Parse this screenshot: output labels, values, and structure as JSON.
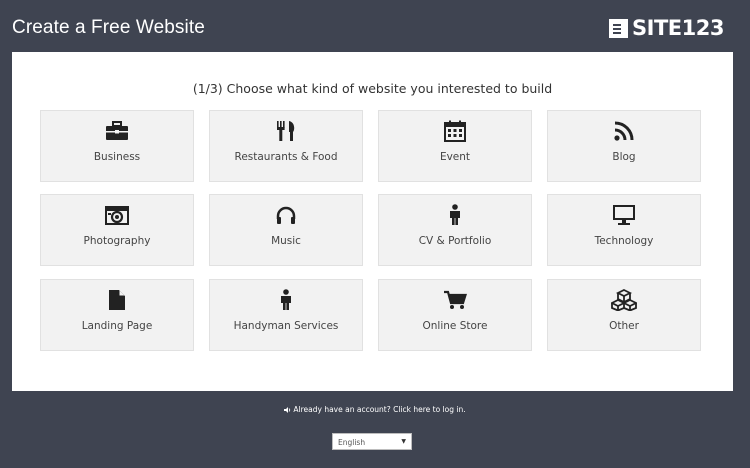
{
  "header": {
    "title": "Create a Free Website",
    "logo_text": "SITE123"
  },
  "panel": {
    "heading": "(1/3) Choose what kind of website you interested to build",
    "categories": [
      {
        "label": "Business",
        "icon": "briefcase-icon"
      },
      {
        "label": "Restaurants & Food",
        "icon": "fork-knife-icon"
      },
      {
        "label": "Event",
        "icon": "calendar-icon"
      },
      {
        "label": "Blog",
        "icon": "rss-icon"
      },
      {
        "label": "Photography",
        "icon": "camera-icon"
      },
      {
        "label": "Music",
        "icon": "headphones-icon"
      },
      {
        "label": "CV & Portfolio",
        "icon": "person-icon"
      },
      {
        "label": "Technology",
        "icon": "monitor-icon"
      },
      {
        "label": "Landing Page",
        "icon": "file-icon"
      },
      {
        "label": "Handyman Services",
        "icon": "person-icon"
      },
      {
        "label": "Online Store",
        "icon": "shopping-cart-icon"
      },
      {
        "label": "Other",
        "icon": "cubes-icon"
      }
    ]
  },
  "footer": {
    "login_link": "Already have an account? Click here to log in.",
    "language": "English"
  },
  "colors": {
    "background": "#3f4451",
    "panel": "#ffffff",
    "tile": "#f2f2f2",
    "icon": "#222222"
  }
}
